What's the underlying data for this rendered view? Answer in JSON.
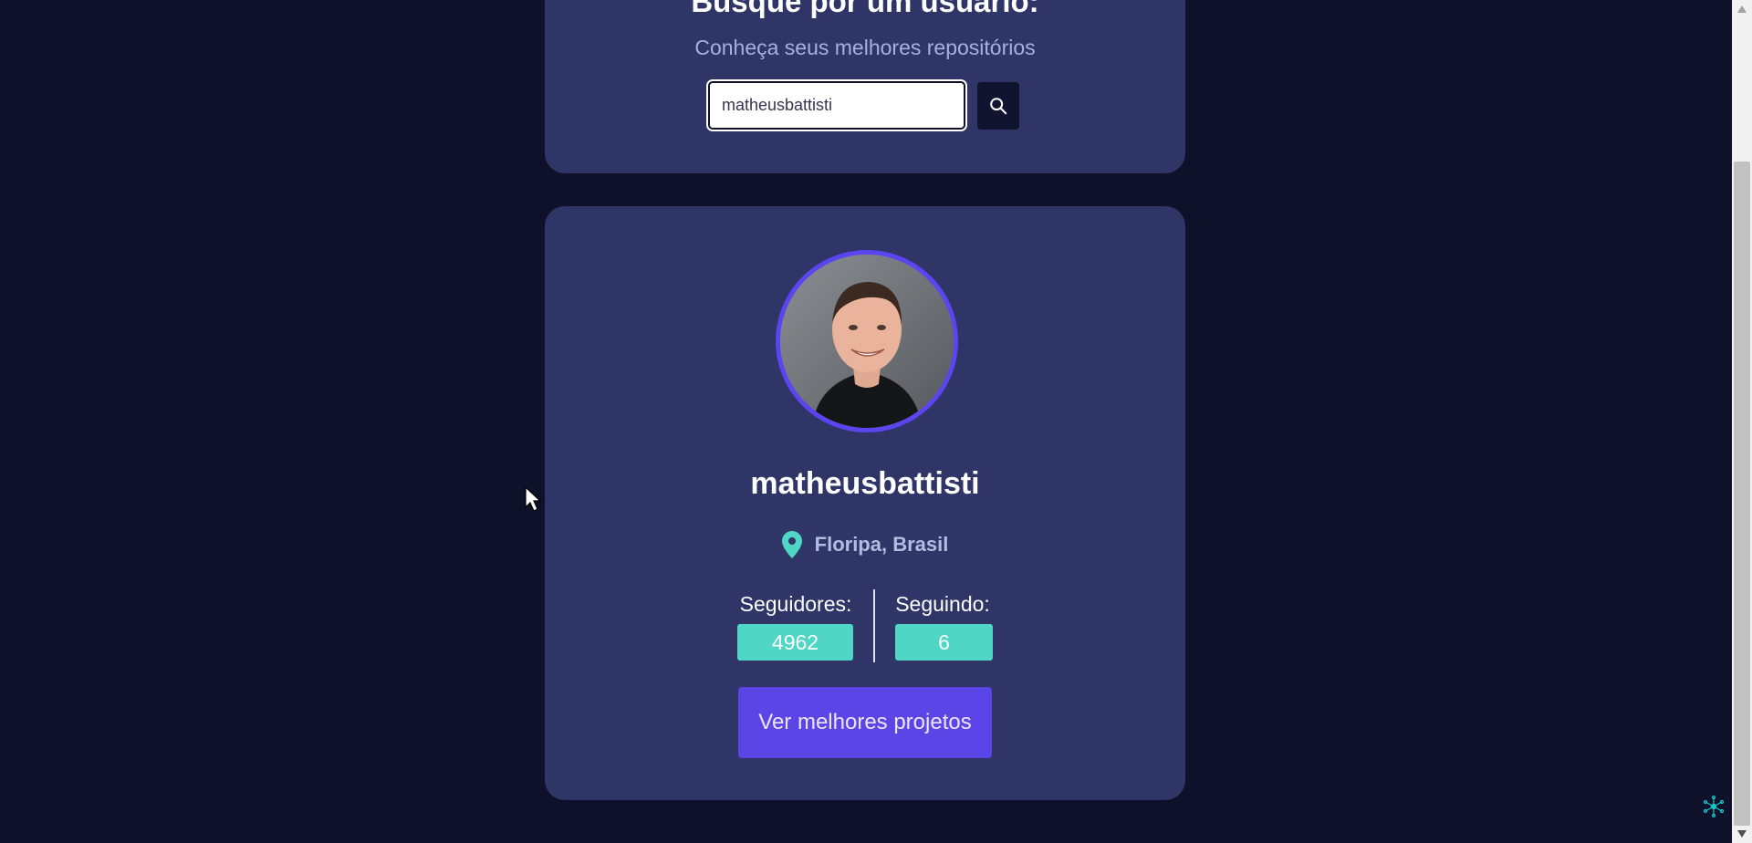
{
  "search": {
    "title": "Busque por um usuário:",
    "subtitle": "Conheça seus melhores repositórios",
    "input_value": "matheusbattisti",
    "button_icon": "search-icon"
  },
  "profile": {
    "username": "matheusbattisti",
    "location_icon": "map-pin-icon",
    "location": "Floripa, Brasil",
    "followers_label": "Seguidores:",
    "followers_value": "4962",
    "following_label": "Seguindo:",
    "following_value": "6",
    "projects_button": "Ver melhores projetos"
  },
  "colors": {
    "background": "#0e1129",
    "card": "#2f3567",
    "accent_purple": "#5b45e6",
    "accent_teal": "#4fd6c4"
  }
}
